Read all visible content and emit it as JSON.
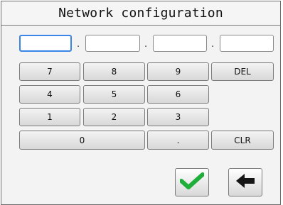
{
  "title": "Network configuration",
  "ip_fields": [
    {
      "value": "",
      "active": true
    },
    {
      "value": "",
      "active": false
    },
    {
      "value": "",
      "active": false
    },
    {
      "value": "",
      "active": false
    }
  ],
  "separator": ".",
  "keypad": {
    "k7": "7",
    "k8": "8",
    "k9": "9",
    "del": "DEL",
    "k4": "4",
    "k5": "5",
    "k6": "6",
    "k1": "1",
    "k2": "2",
    "k3": "3",
    "k0": "0",
    "dot": ".",
    "clr": "CLR"
  },
  "actions": {
    "confirm_icon": "checkmark-icon",
    "back_icon": "arrow-left-icon",
    "confirm_color": "#1fae3a"
  }
}
